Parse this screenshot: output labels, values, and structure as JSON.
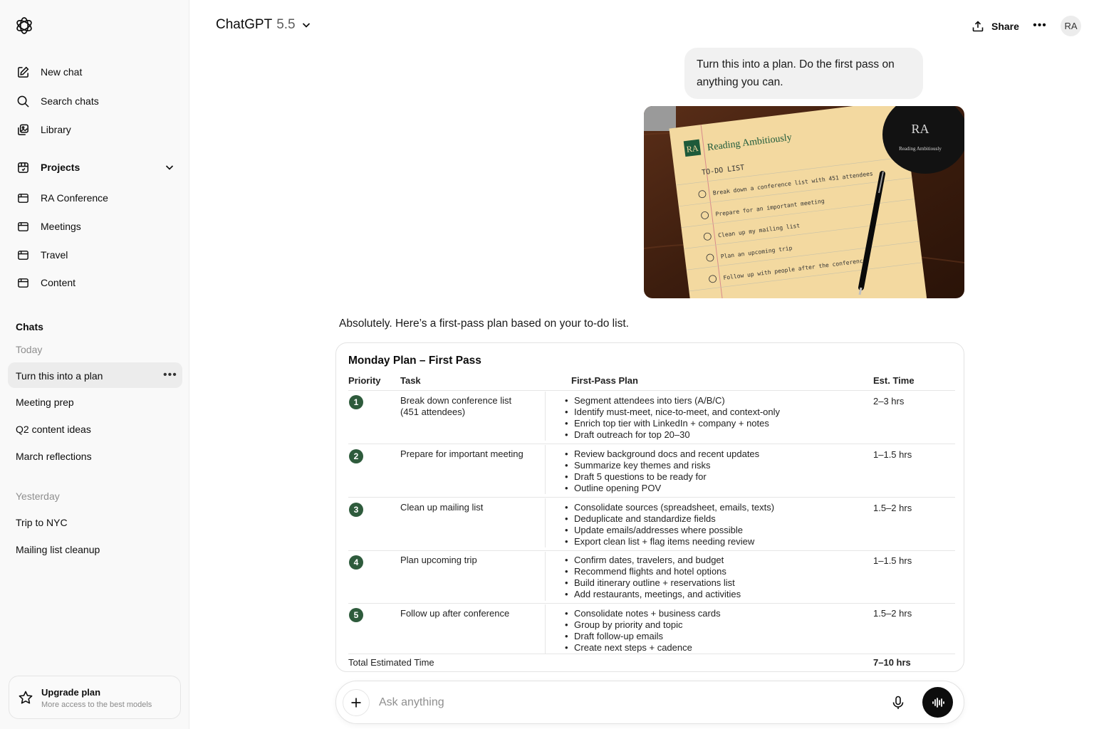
{
  "header": {
    "model_name": "ChatGPT",
    "model_version": "5.5",
    "share_label": "Share",
    "avatar_initials": "RA"
  },
  "sidebar": {
    "nav": [
      {
        "label": "New chat",
        "icon": "new-chat-icon"
      },
      {
        "label": "Search chats",
        "icon": "search-icon"
      },
      {
        "label": "Library",
        "icon": "library-icon"
      }
    ],
    "projects_label": "Projects",
    "projects": [
      {
        "label": "RA Conference",
        "icon": "folder-icon"
      },
      {
        "label": "Meetings",
        "icon": "folder-icon"
      },
      {
        "label": "Travel",
        "icon": "folder-icon"
      },
      {
        "label": "Content",
        "icon": "folder-icon"
      }
    ],
    "chats_label": "Chats",
    "today_label": "Today",
    "today_chats": [
      "Turn this into a plan",
      "Meeting prep",
      "Q2 content ideas",
      "March reflections"
    ],
    "yesterday_label": "Yesterday",
    "yesterday_chats": [
      "Trip to NYC",
      "Mailing list cleanup"
    ],
    "upgrade": {
      "title": "Upgrade plan",
      "subtitle": "More access to the best models"
    }
  },
  "conversation": {
    "user_message": "Turn this into a plan. Do the first pass on anything you can.",
    "attached_image": {
      "brand_mark": "RA",
      "brand_title": "Reading Ambitiously",
      "heading": "TO-DO LIST",
      "items": [
        "Break down a conference list with 451 attendees",
        "Prepare for an important meeting",
        "Clean up my mailing list",
        "Plan an upcoming trip",
        "Follow up with people after the conference"
      ],
      "mug_mark": "RA",
      "mug_text": "Reading Ambitiously"
    },
    "assistant_intro": "Absolutely. Here’s a first-pass plan based on your to-do list.",
    "plan": {
      "title": "Monday Plan – First Pass",
      "columns": [
        "Priority",
        "Task",
        "First-Pass Plan",
        "Est. Time"
      ],
      "rows": [
        {
          "priority": "1",
          "task": "Break down conference list (451 attendees)",
          "steps": [
            "Segment attendees into tiers (A/B/C)",
            "Identify must-meet, nice-to-meet, and context-only",
            "Enrich top tier with LinkedIn + company + notes",
            "Draft outreach for top 20–30"
          ],
          "time": "2–3 hrs"
        },
        {
          "priority": "2",
          "task": "Prepare for important meeting",
          "steps": [
            "Review background docs and recent updates",
            "Summarize key themes and risks",
            "Draft 5 questions to be ready for",
            "Outline opening POV"
          ],
          "time": "1–1.5 hrs"
        },
        {
          "priority": "3",
          "task": "Clean up mailing list",
          "steps": [
            "Consolidate sources (spreadsheet, emails, texts)",
            "Deduplicate and standardize fields",
            "Update emails/addresses where possible",
            "Export clean list + flag items needing review"
          ],
          "time": "1.5–2 hrs"
        },
        {
          "priority": "4",
          "task": "Plan upcoming trip",
          "steps": [
            "Confirm dates, travelers, and budget",
            "Recommend flights and hotel options",
            "Build itinerary outline + reservations list",
            "Add restaurants, meetings, and activities"
          ],
          "time": "1–1.5 hrs"
        },
        {
          "priority": "5",
          "task": "Follow up after conference",
          "steps": [
            "Consolidate notes + business cards",
            "Group by priority and topic",
            "Draft follow-up emails",
            "Create next steps + cadence"
          ],
          "time": "1.5–2 hrs"
        }
      ],
      "total_label": "Total Estimated Time",
      "total_value": "7–10 hrs"
    }
  },
  "composer": {
    "placeholder": "Ask anything",
    "value": ""
  },
  "colors": {
    "sidebar_bg": "#f9f9f9",
    "active_chat_bg": "#ececec",
    "priority_badge": "#2e5b3c",
    "user_bubble_bg": "#f1f1f1",
    "voice_button_bg": "#0d0d0d"
  }
}
